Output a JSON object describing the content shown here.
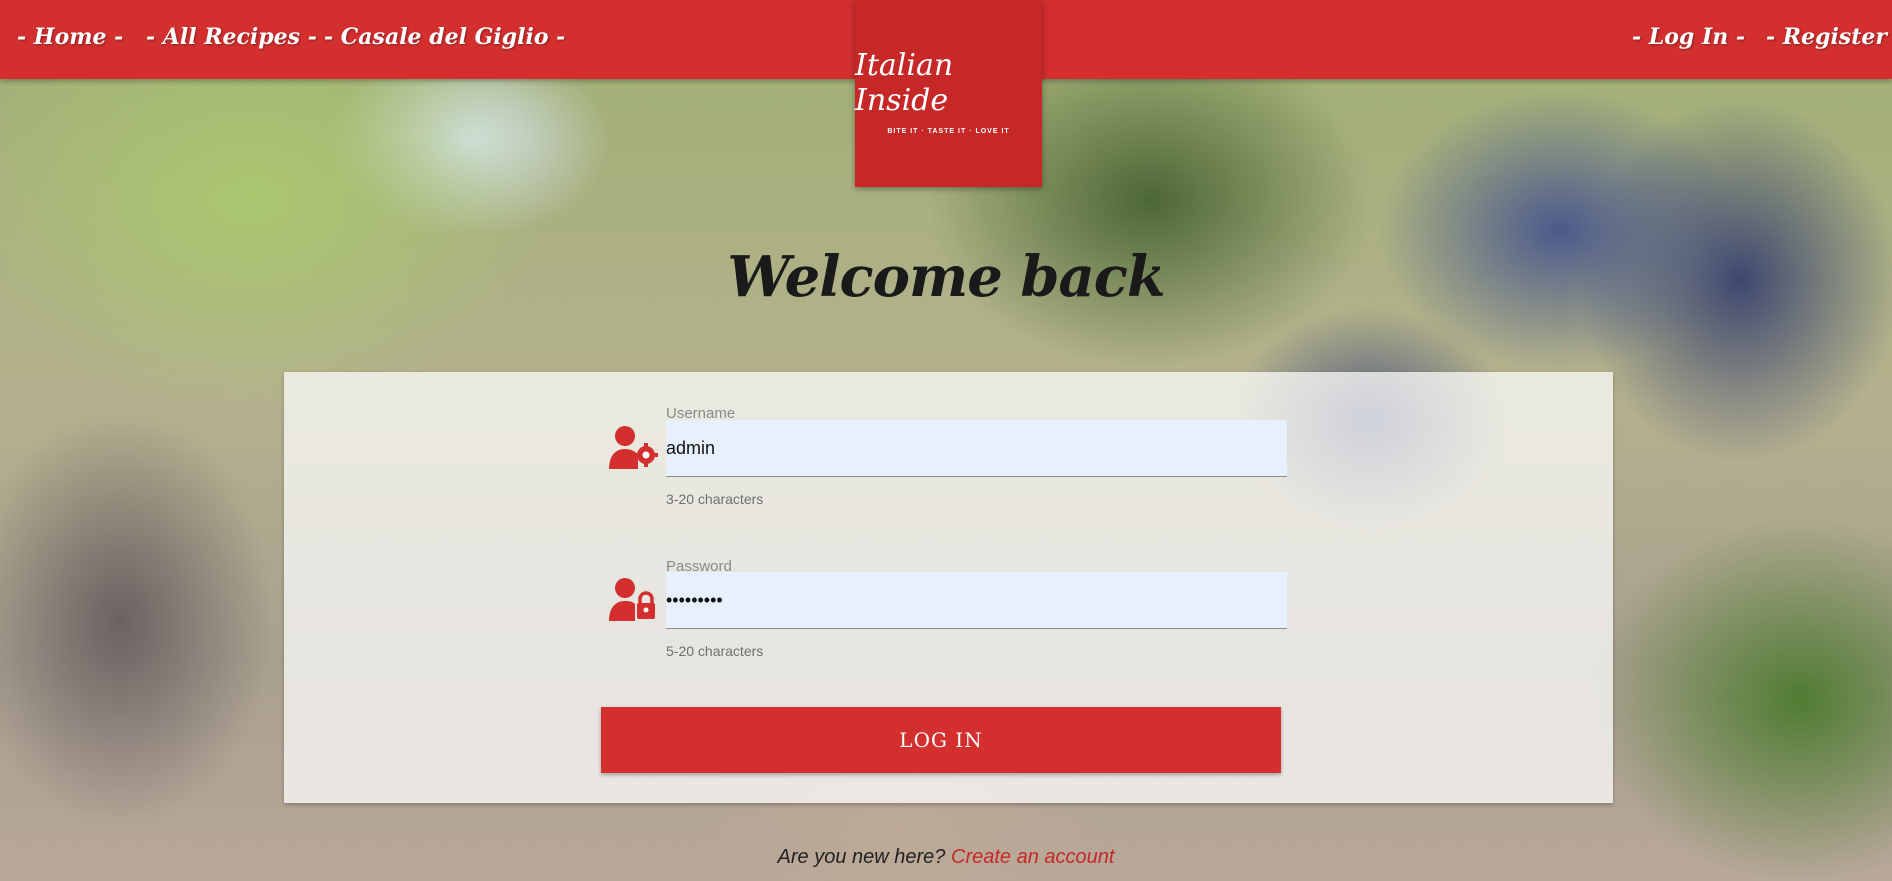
{
  "nav": {
    "home": "- Home -",
    "all_recipes": "- All Recipes -",
    "casale": "- Casale del Giglio -",
    "login": "- Log In -",
    "register": "- Register -"
  },
  "logo": {
    "script": "Italian Inside",
    "tagline": "BITE IT · TASTE IT · LOVE IT"
  },
  "page": {
    "title": "Welcome back"
  },
  "form": {
    "username": {
      "label": "Username",
      "value": "admin",
      "helper": "3-20 characters",
      "icon": "user-cog-icon"
    },
    "password": {
      "label": "Password",
      "value": "•••••••••",
      "helper": "5-20 characters",
      "icon": "user-lock-icon"
    },
    "submit_label": "LOG IN"
  },
  "signup": {
    "prompt": "Are you new here?",
    "link": "Create an account"
  },
  "colors": {
    "primary": "#d32f2f",
    "logo_bg": "#c62828",
    "input_bg": "#e8f0fe"
  }
}
